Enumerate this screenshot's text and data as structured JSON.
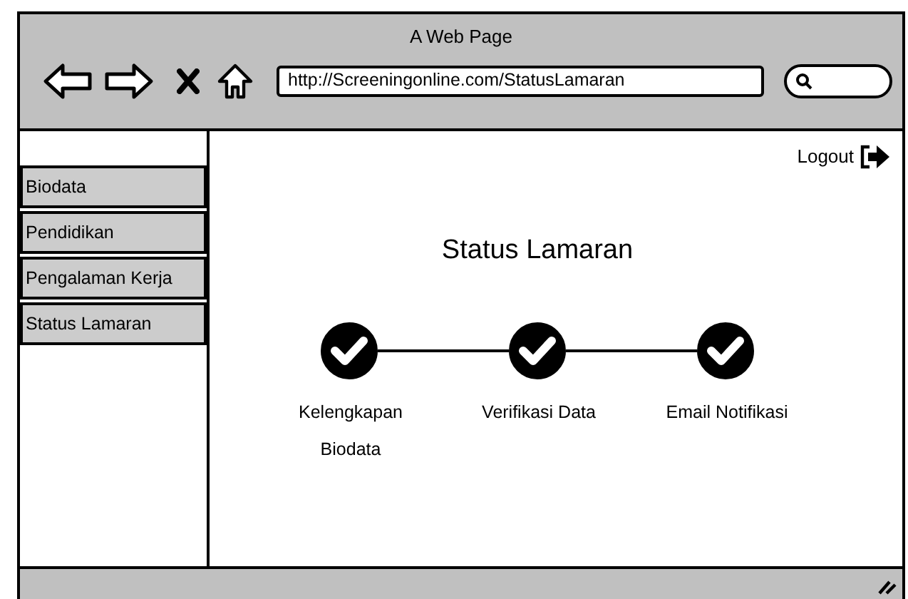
{
  "window": {
    "title": "A Web Page"
  },
  "browser": {
    "url": "http://Screeningonline.com/StatusLamaran"
  },
  "sidebar": {
    "items": [
      {
        "label": "Biodata"
      },
      {
        "label": "Pendidikan"
      },
      {
        "label": "Pengalaman Kerja"
      },
      {
        "label": "Status Lamaran"
      }
    ]
  },
  "logout": {
    "label": "Logout"
  },
  "heading": "Status Lamaran",
  "steps": [
    {
      "label": "Kelengkapan Biodata",
      "done": true
    },
    {
      "label": "Verifikasi Data",
      "done": true
    },
    {
      "label": "Email Notifikasi",
      "done": true
    }
  ]
}
